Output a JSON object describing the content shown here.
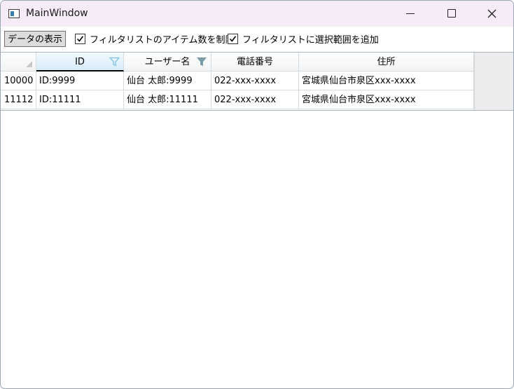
{
  "window": {
    "title": "MainWindow"
  },
  "toolbar": {
    "show_button": "データの表示",
    "limit_filter_checkbox": {
      "label": "フィルタリストのアイテム数を制限",
      "checked": true
    },
    "add_selection_checkbox": {
      "label": "フィルタリストに選択範囲を追加",
      "checked": true
    }
  },
  "grid": {
    "columns": [
      {
        "label": "ID",
        "filter": true
      },
      {
        "label": "ユーザー名",
        "filter": true
      },
      {
        "label": "電話番号",
        "filter": false
      },
      {
        "label": "住所",
        "filter": false
      }
    ],
    "rows": [
      {
        "row_header": "10000",
        "cells": [
          "ID:9999",
          "仙台 太郎:9999",
          "022-xxx-xxxx",
          "宮城県仙台市泉区xxx-xxxx"
        ]
      },
      {
        "row_header": "11112",
        "cells": [
          "ID:11111",
          "仙台 太郎:11111",
          "022-xxx-xxxx",
          "宮城県仙台市泉区xxx-xxxx"
        ]
      }
    ]
  },
  "colors": {
    "filter_active": "#7a9aa8",
    "filter_light": "#7fc3e0",
    "header_selected": "#d6ebf8"
  }
}
